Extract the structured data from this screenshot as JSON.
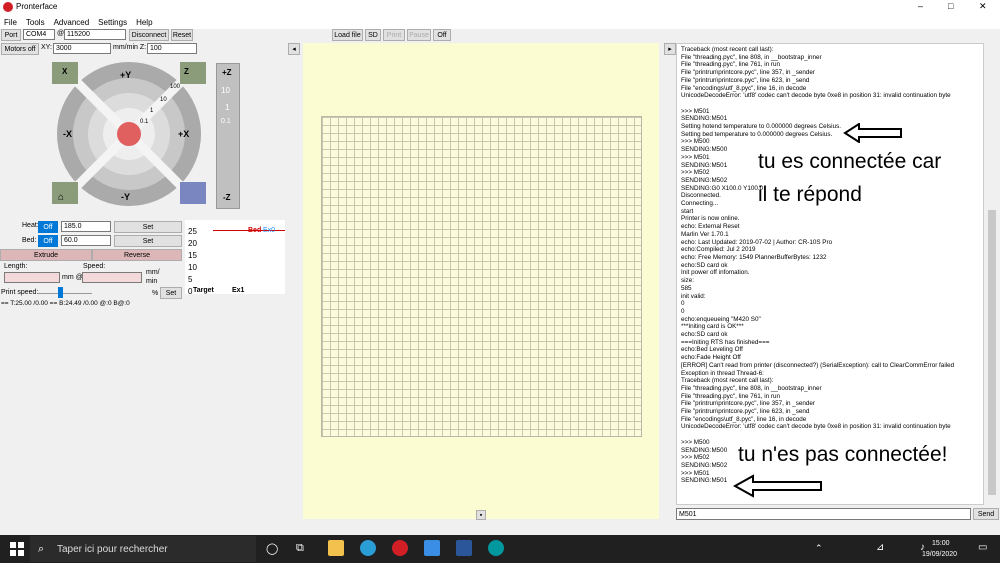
{
  "window": {
    "title": "Pronterface",
    "min": "–",
    "max": "□",
    "close": "✕"
  },
  "menu": [
    "File",
    "Tools",
    "Advanced",
    "Settings",
    "Help"
  ],
  "conn": {
    "port_label": "Port",
    "port_value": "COM4",
    "at": "@",
    "baud": "115200",
    "disconnect": "Disconnect",
    "reset": "Reset"
  },
  "motors": {
    "off": "Motors off",
    "xy_label": "XY:",
    "xy_value": "3000",
    "mm_min": "mm/min Z:",
    "z_value": "100"
  },
  "top_toolbar": {
    "load": "Load file",
    "sd": "SD",
    "print": "Print",
    "pause": "Pause",
    "off": "Off"
  },
  "jog": {
    "home_x": "X",
    "home_y": "Y",
    "home_z": "Z",
    "plus_y": "+Y",
    "minus_y": "-Y",
    "plus_x": "+X",
    "minus_x": "-X",
    "steps": [
      "100",
      "10",
      "1",
      "0.1"
    ],
    "z_plus": "+Z",
    "z_minus": "-Z",
    "z_steps": [
      "10",
      "1",
      "0.1"
    ]
  },
  "temp": {
    "heat": "Heat:",
    "heat_off": "Off",
    "heat_val": "185.0",
    "heat_set": "Set",
    "bed": "Bed:",
    "bed_off": "Off",
    "bed_val": "60.0",
    "bed_set": "Set",
    "extrude": "Extrude",
    "reverse": "Reverse",
    "length": "Length:",
    "speed": "Speed:",
    "mm_at": "mm @",
    "mm_min1": "mm/",
    "mm_min2": "min",
    "print_speed": "Print speed:",
    "pct": "%",
    "pset": "Set",
    "status": "== T:25.00 /0.00 == B:24.49 /0.00 @:0 B@:0"
  },
  "graph": {
    "ticks": [
      "25",
      "20",
      "15",
      "10",
      "5",
      "0"
    ],
    "bed": "Bed",
    "ex0": "Ex0",
    "target": "Target",
    "ex1": "Ex1"
  },
  "console_lines": [
    "Traceback (most recent call last):",
    "  File \"threading.pyc\", line 808, in __bootstrap_inner",
    "  File \"threading.pyc\", line 761, in run",
    "  File \"printrun\\printcore.pyc\", line 357, in _sender",
    "  File \"printrun\\printcore.pyc\", line 623, in _send",
    "  File \"encodings\\utf_8.pyc\", line 16, in decode",
    "UnicodeDecodeError: 'utf8' codec can't decode byte 0xe8 in position 31: invalid continuation byte",
    "",
    ">>> M501",
    "SENDING:M501",
    "Setting hotend temperature to 0.000000 degrees Celsius.",
    "Setting bed temperature to 0.000000 degrees Celsius.",
    ">>> M500",
    "SENDING:M500",
    ">>> M501",
    "SENDING:M501",
    ">>> M502",
    "SENDING:M502",
    "SENDING:G0 X100.0 Y100.0",
    "Disconnected.",
    "Connecting...",
    "start",
    "Printer is now online.",
    "echo: External Reset",
    "Marlin Ver 1.70.1",
    "echo: Last Updated: 2019-07-02 | Author: CR-10S Pro",
    "echo:Compiled: Jul  2 2019",
    "echo: Free Memory: 1549  PlannerBufferBytes: 1232",
    "echo:SD card ok",
    "Init power off infomation.",
    "size:",
    "585",
    "init valid:",
    "0",
    "0",
    "echo:enqueueing \"M420 S0\"",
    "***Initing card is OK***",
    "echo:SD card ok",
    "===Initing RTS has finished===",
    "echo:Bed Leveling Off",
    "echo:Fade Height Off",
    "[ERROR] Can't read from printer (disconnected?) (SerialException): call to ClearCommError failed",
    "Exception in thread Thread-6:",
    "Traceback (most recent call last):",
    "  File \"threading.pyc\", line 808, in __bootstrap_inner",
    "  File \"threading.pyc\", line 761, in run",
    "  File \"printrun\\printcore.pyc\", line 357, in _sender",
    "  File \"printrun\\printcore.pyc\", line 623, in _send",
    "  File \"encodings\\utf_8.pyc\", line 16, in decode",
    "UnicodeDecodeError: 'utf8' codec can't decode byte 0xe8 in position 31: invalid continuation byte",
    "",
    ">>> M500",
    "SENDING:M500",
    ">>> M502",
    "SENDING:M502",
    ">>> M501",
    "SENDING:M501"
  ],
  "command": {
    "value": "M501",
    "send": "Send"
  },
  "annotations": {
    "a1": "tu es connectée car",
    "a2": "il te répond",
    "a3": "tu n'es pas connectée!"
  },
  "taskbar": {
    "search": "Taper ici pour rechercher",
    "time": "15:00",
    "date": "19/09/2020"
  },
  "colors": {
    "accent": "#0078d7",
    "bed_line": "#d00000",
    "ex0_line": "#1e90ff",
    "grid_bg": "#fcfcdc"
  }
}
